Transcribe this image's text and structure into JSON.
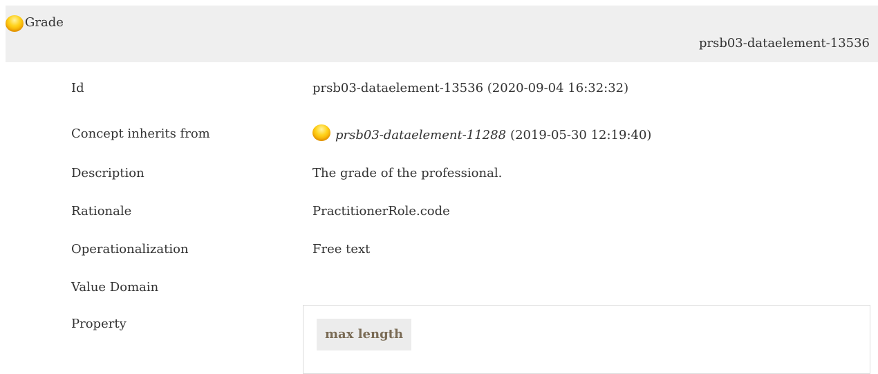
{
  "header": {
    "title": "Grade",
    "id": "prsb03-dataelement-13536",
    "icon": "concept-orb-icon"
  },
  "rows": [
    {
      "label": "Id",
      "value": "prsb03-dataelement-13536 (2020-09-04 16:32:32)"
    },
    {
      "label": "Concept inherits from",
      "link": "prsb03-dataelement-11288",
      "value": "(2019-05-30 12:19:40)"
    },
    {
      "label": "Description",
      "value": "The grade of the professional."
    },
    {
      "label": "Rationale",
      "value": "PractitionerRole.code"
    },
    {
      "label": "Operationalization",
      "value": "Free text"
    },
    {
      "label": "Value Domain",
      "value": ""
    },
    {
      "label": "Property",
      "value": ""
    }
  ],
  "property": {
    "chip_label": "max length"
  },
  "colors": {
    "header_bg": "#efefef",
    "chip_bg": "#ececec",
    "chip_text": "#7a6b55",
    "orb": "#ffd21a"
  }
}
